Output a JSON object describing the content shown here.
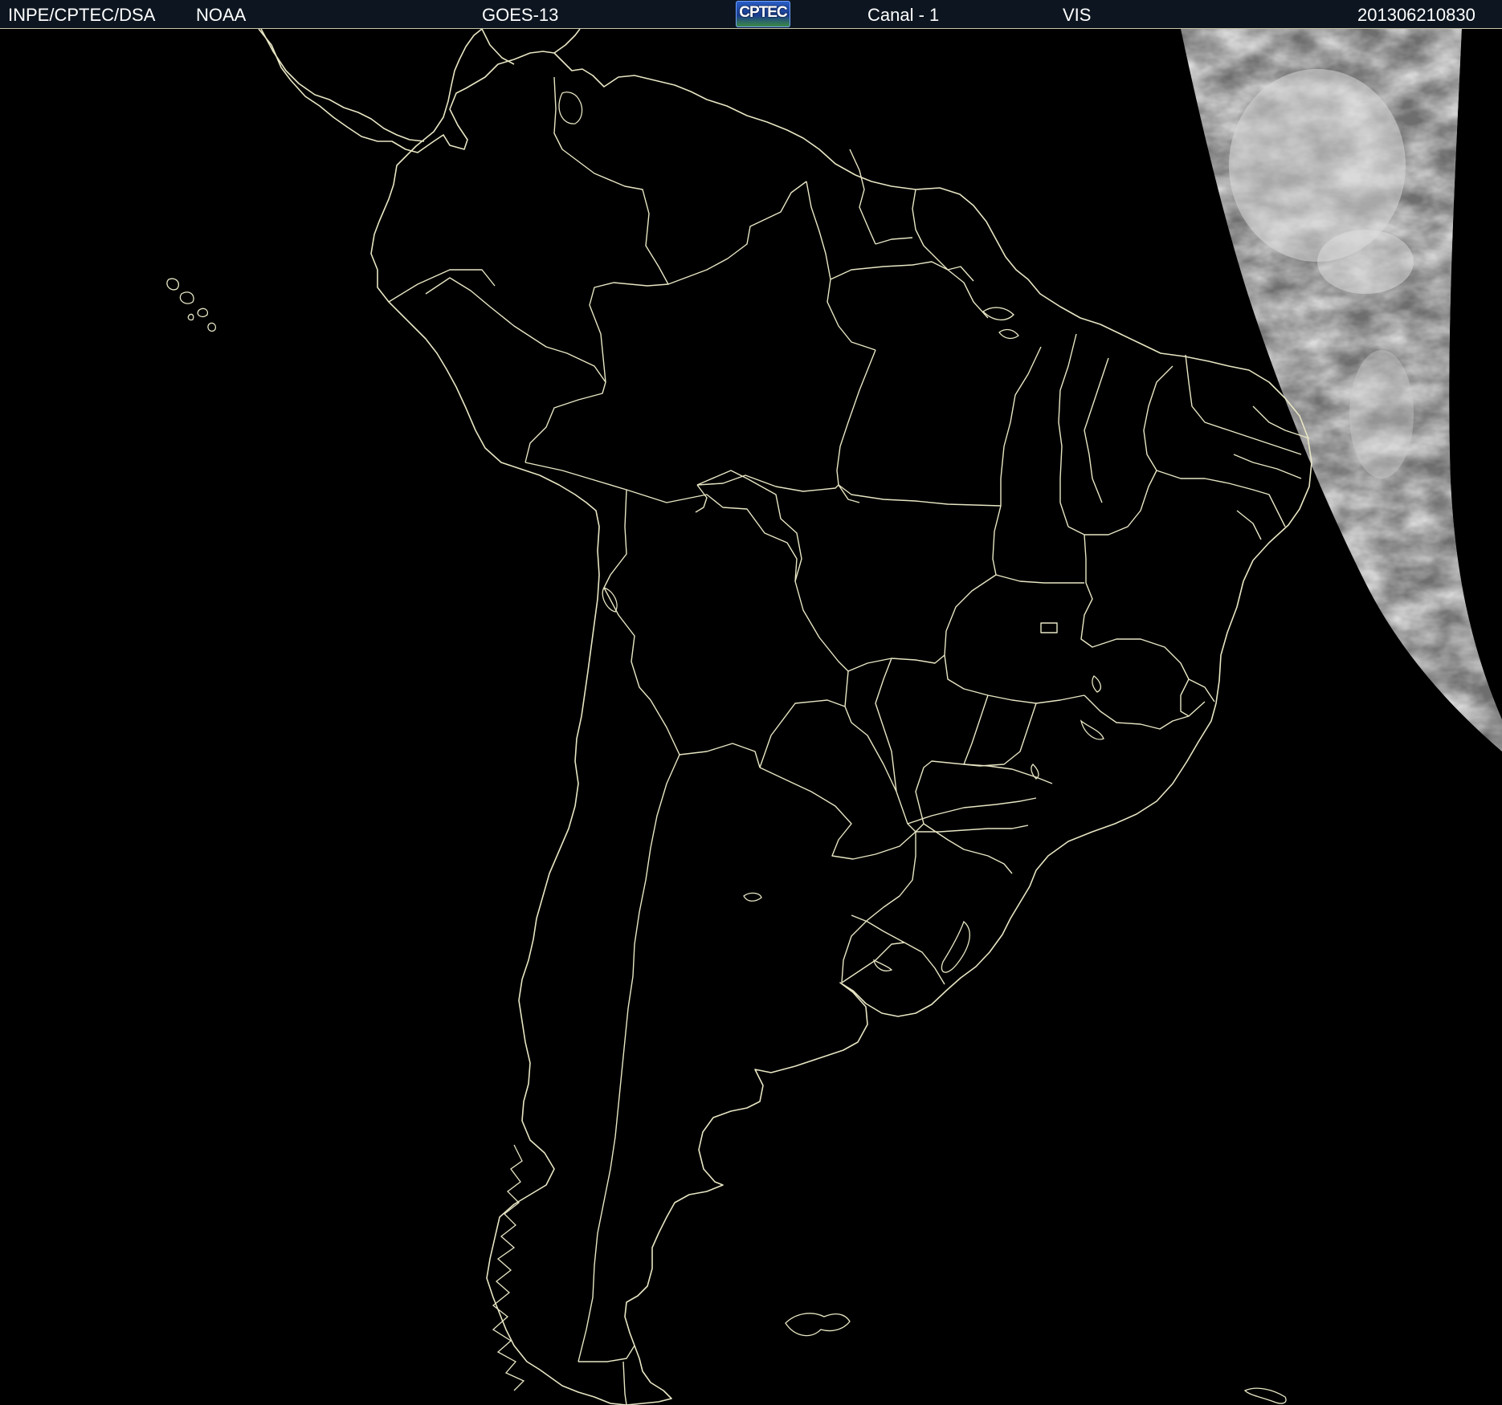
{
  "header": {
    "agency": "INPE/CPTEC/DSA",
    "source": "NOAA",
    "satellite": "GOES-13",
    "logo_text": "CPTEC",
    "channel": "Canal - 1",
    "band": "VIS",
    "timestamp": "201306210830"
  },
  "colors": {
    "background": "#000000",
    "header_bg": "#0d1620",
    "outline": "#e8e6c4",
    "cloud_light": "#d8d8d8",
    "cloud_dark": "#5a5a5a"
  },
  "icons": {
    "logo": "cptec-logo-icon"
  }
}
